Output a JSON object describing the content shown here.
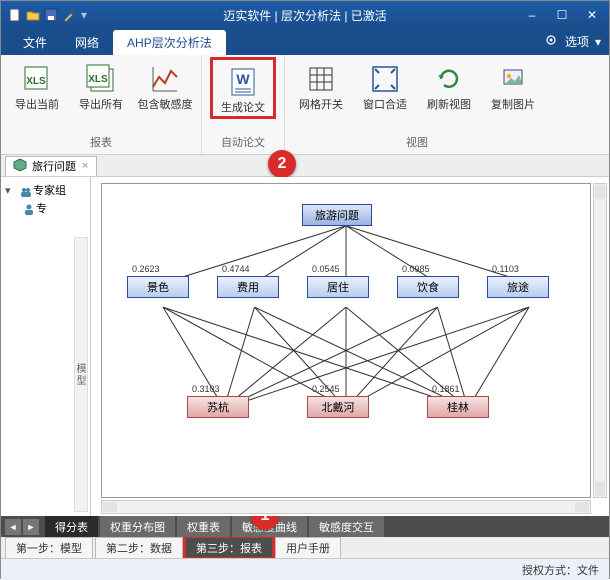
{
  "title": "迈实软件 | 层次分析法 | 已激活",
  "quick_access": {
    "new": "new-file-icon",
    "open": "open-folder-icon",
    "save": "save-icon",
    "tools": "tools-icon"
  },
  "window_buttons": {
    "min": "–",
    "max": "☐",
    "close": "✕"
  },
  "menu": {
    "tabs": [
      "文件",
      "网络",
      "AHP层次分析法"
    ],
    "active_index": 2,
    "right": {
      "gear": "gear-icon",
      "options": "选项",
      "dropdown": "▾"
    }
  },
  "ribbon": {
    "groups": [
      {
        "title": "报表",
        "items": [
          {
            "id": "export-current",
            "label": "导出当前"
          },
          {
            "id": "export-all",
            "label": "导出所有"
          },
          {
            "id": "include-sens",
            "label": "包含敏感度"
          }
        ]
      },
      {
        "title": "自动论文",
        "items": [
          {
            "id": "generate-paper",
            "label": "生成论文",
            "highlight": true
          }
        ]
      },
      {
        "title": "视图",
        "items": [
          {
            "id": "grid-toggle",
            "label": "网格开关"
          },
          {
            "id": "fit-window",
            "label": "窗口合适"
          },
          {
            "id": "refresh-view",
            "label": "刷新视图"
          },
          {
            "id": "copy-image",
            "label": "复制图片"
          }
        ]
      }
    ]
  },
  "doc_tabs": {
    "items": [
      {
        "icon": "cube-icon",
        "label": "旅行问题",
        "closeable": true
      }
    ]
  },
  "sidebar": {
    "tree": [
      {
        "expander": "▾",
        "icon": "users-icon",
        "label": "专家组"
      },
      {
        "expander": "",
        "icon": "user-icon",
        "label": "专",
        "indent": 1
      }
    ],
    "vertical_tab": "模型"
  },
  "chart_data": {
    "type": "hierarchy",
    "goal": "旅游问题",
    "criteria": [
      {
        "name": "景色",
        "weight": 0.2623
      },
      {
        "name": "费用",
        "weight": 0.4744
      },
      {
        "name": "居住",
        "weight": 0.0545
      },
      {
        "name": "饮食",
        "weight": 0.0985
      },
      {
        "name": "旅途",
        "weight": 0.1103
      }
    ],
    "alternatives": [
      {
        "name": "苏杭",
        "weight": 0.3103
      },
      {
        "name": "北戴河",
        "weight": 0.2545
      },
      {
        "name": "桂林",
        "weight": 0.1861
      }
    ],
    "edges": "full-bipartite"
  },
  "inner_tabs": {
    "items": [
      "得分表",
      "权重分布图",
      "权重表",
      "敏感度曲线",
      "敏感度交互"
    ],
    "active_index": 0
  },
  "step_tabs": {
    "items": [
      "第一步：模型",
      "第二步：数据",
      "第三步：报表",
      "用户手册"
    ],
    "highlight_index": 2
  },
  "statusbar": {
    "right_label": "授权方式：",
    "right_value": "文件"
  },
  "annotations": {
    "badge1": "1",
    "badge2": "2"
  }
}
